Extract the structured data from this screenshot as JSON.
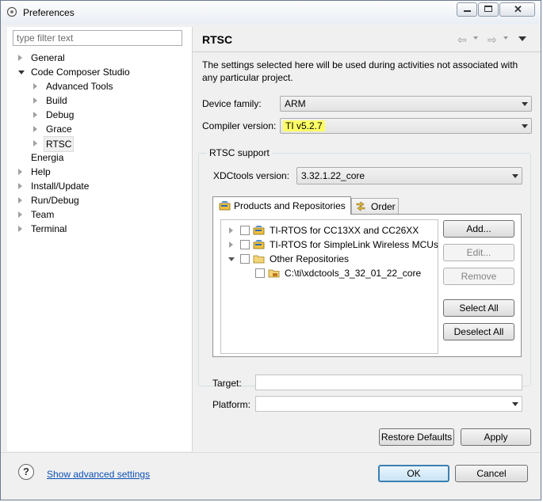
{
  "window": {
    "title": "Preferences"
  },
  "filter": {
    "placeholder": "type filter text"
  },
  "tree": [
    {
      "label": "General",
      "arrow": "right"
    },
    {
      "label": "Code Composer Studio",
      "arrow": "down"
    },
    {
      "label": "Advanced Tools",
      "arrow": "right"
    },
    {
      "label": "Build",
      "arrow": "right"
    },
    {
      "label": "Debug",
      "arrow": "right"
    },
    {
      "label": "Grace",
      "arrow": "right"
    },
    {
      "label": "RTSC",
      "arrow": "right"
    },
    {
      "label": "Energia",
      "arrow": "none"
    },
    {
      "label": "Help",
      "arrow": "right"
    },
    {
      "label": "Install/Update",
      "arrow": "right"
    },
    {
      "label": "Run/Debug",
      "arrow": "right"
    },
    {
      "label": "Team",
      "arrow": "right"
    },
    {
      "label": "Terminal",
      "arrow": "right"
    }
  ],
  "page": {
    "title": "RTSC",
    "description": "The settings selected here will be used during activities not associated with any particular project.",
    "device_family_label": "Device family:",
    "device_family_value": "ARM",
    "compiler_version_label": "Compiler version:",
    "compiler_version_value": "TI v5.2.7",
    "rtsc_support_label": "RTSC support",
    "xdctools_label": "XDCtools version:",
    "xdctools_value": "3.32.1.22_core",
    "tabs": {
      "products": "Products and Repositories",
      "order": "Order"
    },
    "repo_items": {
      "item1": "TI-RTOS for CC13XX and CC26XX",
      "item2": "TI-RTOS for SimpleLink Wireless MCUs",
      "item3": "Other Repositories",
      "item4": "C:\\ti\\xdctools_3_32_01_22_core"
    },
    "buttons": {
      "add": "Add...",
      "edit": "Edit...",
      "remove": "Remove",
      "select_all": "Select All",
      "deselect_all": "Deselect All",
      "restore_defaults": "Restore Defaults",
      "apply": "Apply"
    },
    "target_label": "Target:",
    "platform_label": "Platform:"
  },
  "bottom": {
    "help_icon": "?",
    "advanced_link": "Show advanced settings",
    "ok": "OK",
    "cancel": "Cancel"
  },
  "colors": {
    "highlight": "#ffff66",
    "link": "#0b4fb4",
    "ok_border": "#3c7fb1"
  }
}
